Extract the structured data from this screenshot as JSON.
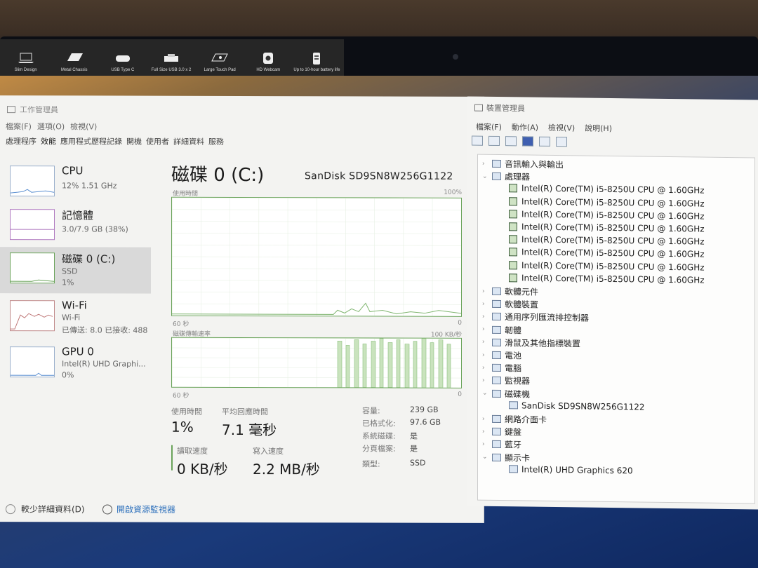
{
  "sticker": {
    "features": [
      {
        "label": "Slim Design",
        "icon": "laptop-icon"
      },
      {
        "label": "Metal Chassis",
        "icon": "laptop-lid-icon"
      },
      {
        "label": "USB Type C",
        "icon": "usb-c-icon"
      },
      {
        "label": "Full Size USB 3.0 x 2",
        "icon": "usb-a-icon"
      },
      {
        "label": "Large Touch Pad",
        "icon": "touchpad-icon"
      },
      {
        "label": "HD Webcam",
        "icon": "webcam-icon"
      },
      {
        "label": "Up to 10-hour battery life",
        "icon": "battery-icon"
      }
    ]
  },
  "task_manager": {
    "title": "工作管理員",
    "menu": [
      "檔案(F)",
      "選項(O)",
      "檢視(V)"
    ],
    "tabs": [
      "處理程序",
      "效能",
      "應用程式歷程記錄",
      "開機",
      "使用者",
      "詳細資料",
      "服務"
    ],
    "sidebar": [
      {
        "name": "CPU",
        "sub1": "12% 1.51 GHz",
        "sub2": ""
      },
      {
        "name": "記憶體",
        "sub1": "3.0/7.9 GB (38%)",
        "sub2": ""
      },
      {
        "name": "磁碟 0 (C:)",
        "sub1": "SSD",
        "sub2": "1%"
      },
      {
        "name": "Wi-Fi",
        "sub1": "Wi-Fi",
        "sub2": "已傳送: 8.0 已接收: 488"
      },
      {
        "name": "GPU 0",
        "sub1": "Intel(R) UHD Graphi...",
        "sub2": "0%"
      }
    ],
    "main": {
      "heading": "磁碟 0 (C:)",
      "model": "SanDisk SD9SN8W256G1122",
      "graph1_label": "使用時間",
      "graph1_max": "100%",
      "graph1_time": "60 秒",
      "graph1_min": "0",
      "graph2_label": "磁碟傳輸速率",
      "graph2_max": "100 KB/秒",
      "graph2_time": "60 秒",
      "graph2_min": "0",
      "active_time_label": "使用時間",
      "active_time_value": "1%",
      "response_label": "平均回應時間",
      "response_value": "7.1 毫秒",
      "read_label": "讀取速度",
      "read_value": "0 KB/秒",
      "write_label": "寫入速度",
      "write_value": "2.2 MB/秒",
      "props": [
        {
          "label": "容量:",
          "value": "239 GB"
        },
        {
          "label": "已格式化:",
          "value": "97.6 GB"
        },
        {
          "label": "系統磁碟:",
          "value": "是"
        },
        {
          "label": "分頁檔案:",
          "value": "是"
        },
        {
          "label": "類型:",
          "value": "SSD"
        }
      ]
    },
    "footer": {
      "fewer_details": "較少詳細資料(D)",
      "open_monitor": "開啟資源監視器"
    }
  },
  "device_manager": {
    "title": "裝置管理員",
    "menu": [
      "檔案(F)",
      "動作(A)",
      "檢視(V)",
      "說明(H)"
    ],
    "tree": [
      {
        "text": "音訊輸入與輸出",
        "level": 1,
        "chev": "›"
      },
      {
        "text": "處理器",
        "level": 1,
        "chev": "⌄"
      },
      {
        "text": "Intel(R) Core(TM) i5-8250U CPU @ 1.60GHz",
        "level": 2,
        "chev": ""
      },
      {
        "text": "Intel(R) Core(TM) i5-8250U CPU @ 1.60GHz",
        "level": 2,
        "chev": ""
      },
      {
        "text": "Intel(R) Core(TM) i5-8250U CPU @ 1.60GHz",
        "level": 2,
        "chev": ""
      },
      {
        "text": "Intel(R) Core(TM) i5-8250U CPU @ 1.60GHz",
        "level": 2,
        "chev": ""
      },
      {
        "text": "Intel(R) Core(TM) i5-8250U CPU @ 1.60GHz",
        "level": 2,
        "chev": ""
      },
      {
        "text": "Intel(R) Core(TM) i5-8250U CPU @ 1.60GHz",
        "level": 2,
        "chev": ""
      },
      {
        "text": "Intel(R) Core(TM) i5-8250U CPU @ 1.60GHz",
        "level": 2,
        "chev": ""
      },
      {
        "text": "Intel(R) Core(TM) i5-8250U CPU @ 1.60GHz",
        "level": 2,
        "chev": ""
      },
      {
        "text": "軟體元件",
        "level": 1,
        "chev": "›"
      },
      {
        "text": "軟體裝置",
        "level": 1,
        "chev": "›"
      },
      {
        "text": "通用序列匯流排控制器",
        "level": 1,
        "chev": "›"
      },
      {
        "text": "韌體",
        "level": 1,
        "chev": "›"
      },
      {
        "text": "滑鼠及其他指標裝置",
        "level": 1,
        "chev": "›"
      },
      {
        "text": "電池",
        "level": 1,
        "chev": "›"
      },
      {
        "text": "電腦",
        "level": 1,
        "chev": "›"
      },
      {
        "text": "監視器",
        "level": 1,
        "chev": "›"
      },
      {
        "text": "磁碟機",
        "level": 1,
        "chev": "⌄"
      },
      {
        "text": "SanDisk SD9SN8W256G1122",
        "level": 2,
        "chev": ""
      },
      {
        "text": "網路介面卡",
        "level": 1,
        "chev": "›"
      },
      {
        "text": "鍵盤",
        "level": 1,
        "chev": "›"
      },
      {
        "text": "藍牙",
        "level": 1,
        "chev": "›"
      },
      {
        "text": "顯示卡",
        "level": 1,
        "chev": "⌄"
      },
      {
        "text": "Intel(R) UHD Graphics 620",
        "level": 2,
        "chev": ""
      }
    ]
  }
}
